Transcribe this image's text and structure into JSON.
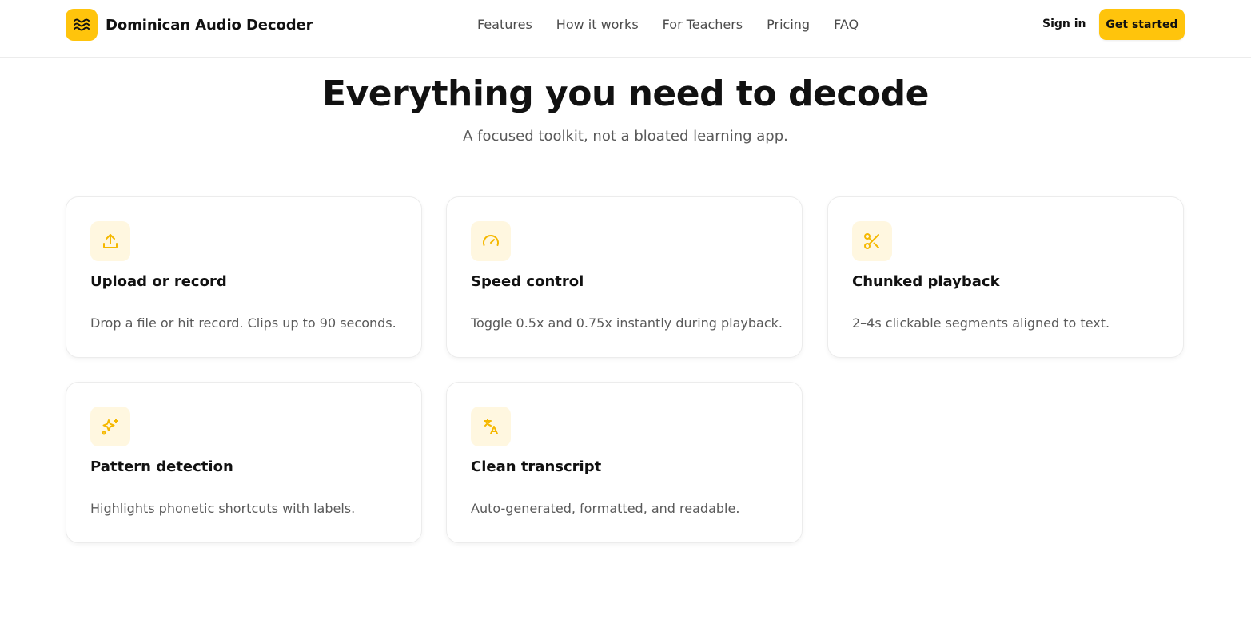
{
  "brand": {
    "name": "Dominican Audio Decoder",
    "logo_icon": "waves-icon",
    "accent": "#FFC40C"
  },
  "nav": {
    "items": [
      "Features",
      "How it works",
      "For Teachers",
      "Pricing",
      "FAQ"
    ]
  },
  "auth": {
    "signin_label": "Sign in",
    "cta_label": "Get started"
  },
  "hero": {
    "title": "Everything you need to decode",
    "subtitle": "A focused toolkit, not a bloated learning app."
  },
  "features": [
    {
      "icon": "upload-icon",
      "title": "Upload or record",
      "desc": "Drop a file or hit record. Clips up to 90 seconds."
    },
    {
      "icon": "gauge-icon",
      "title": "Speed control",
      "desc": "Toggle 0.5x and 0.75x instantly during playback."
    },
    {
      "icon": "scissors-icon",
      "title": "Chunked playback",
      "desc": "2–4s clickable segments aligned to text."
    },
    {
      "icon": "sparkles-icon",
      "title": "Pattern detection",
      "desc": "Highlights phonetic shortcuts with labels."
    },
    {
      "icon": "translate-icon",
      "title": "Clean transcript",
      "desc": "Auto-generated, formatted, and readable."
    }
  ],
  "colors": {
    "icon_tint": "#F5B800",
    "icon_bg": "#FFF7E0",
    "text_muted": "#5a5a5a"
  }
}
